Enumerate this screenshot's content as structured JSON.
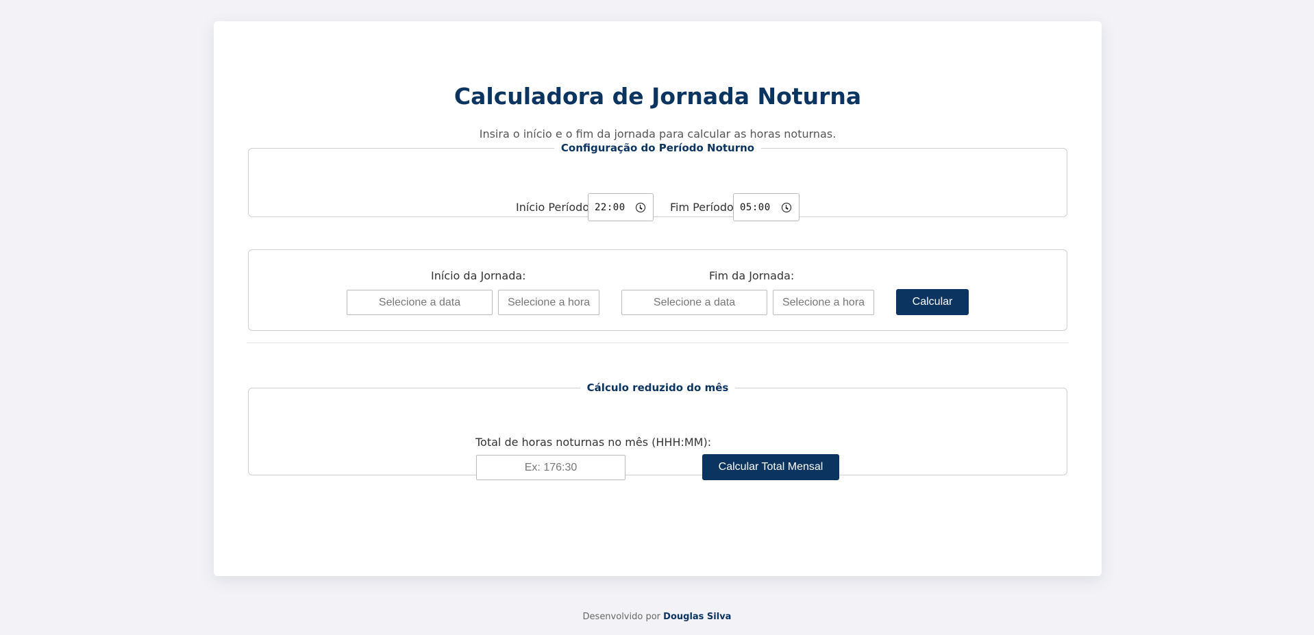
{
  "header": {
    "title": "Calculadora de Jornada Noturna",
    "subtitle": "Insira o início e o fim da jornada para calcular as horas noturnas."
  },
  "night_period": {
    "legend": "Configuração do Período Noturno",
    "start_label": "Início Período:",
    "start_value": "22:00",
    "end_label": "Fim Período:",
    "end_value": "05:00",
    "icon": "clock-icon"
  },
  "shift": {
    "start_label": "Início da Jornada:",
    "start_date_placeholder": "Selecione a data",
    "start_time_placeholder": "Selecione a hora",
    "end_label": "Fim da Jornada:",
    "end_date_placeholder": "Selecione a data",
    "end_time_placeholder": "Selecione a hora",
    "calculate_label": "Calcular"
  },
  "monthly": {
    "legend": "Cálculo reduzido do mês",
    "total_label": "Total de horas noturnas no mês (HHH:MM):",
    "total_placeholder": "Ex: 176:30",
    "calculate_label": "Calcular Total Mensal"
  },
  "footer": {
    "prefix": "Desenvolvido por",
    "author": "Douglas Silva"
  },
  "colors": {
    "accent": "#0b3460",
    "background": "#f3f3f7",
    "card": "#ffffff"
  }
}
